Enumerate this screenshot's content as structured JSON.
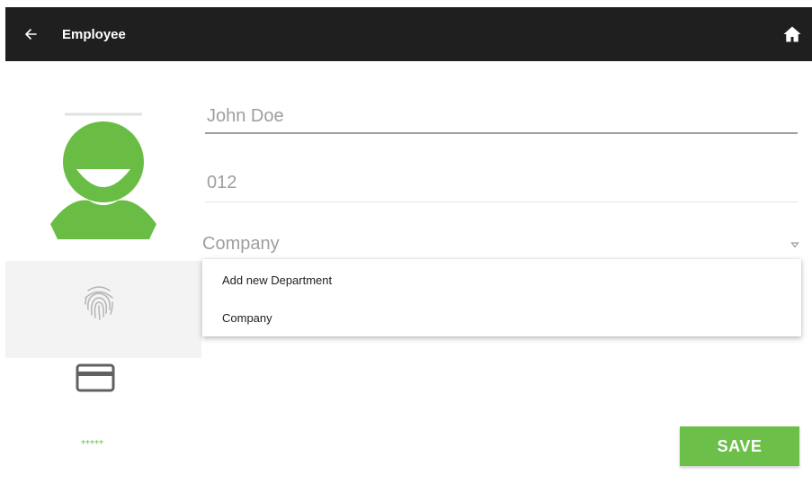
{
  "toolbar": {
    "back_icon": "arrow-left-icon",
    "title": "Employee",
    "home_icon": "home-icon",
    "background": "#1f1f1f"
  },
  "form": {
    "name_value": "John Doe",
    "id_value": "012",
    "company_value": "Company",
    "company_arrow_icon": "dropdown-arrow-icon"
  },
  "dropdown": {
    "options": [
      "Add new Department",
      "Company"
    ]
  },
  "sidebar": {
    "avatar_icon": "user-avatar-icon",
    "fingerprint_icon": "fingerprint-icon",
    "card_icon": "credit-card-icon",
    "pin_text": "*****"
  },
  "actions": {
    "save_label": "SAVE"
  },
  "colors": {
    "accent": "#6cc04a",
    "toolbar": "#1f1f1f"
  }
}
